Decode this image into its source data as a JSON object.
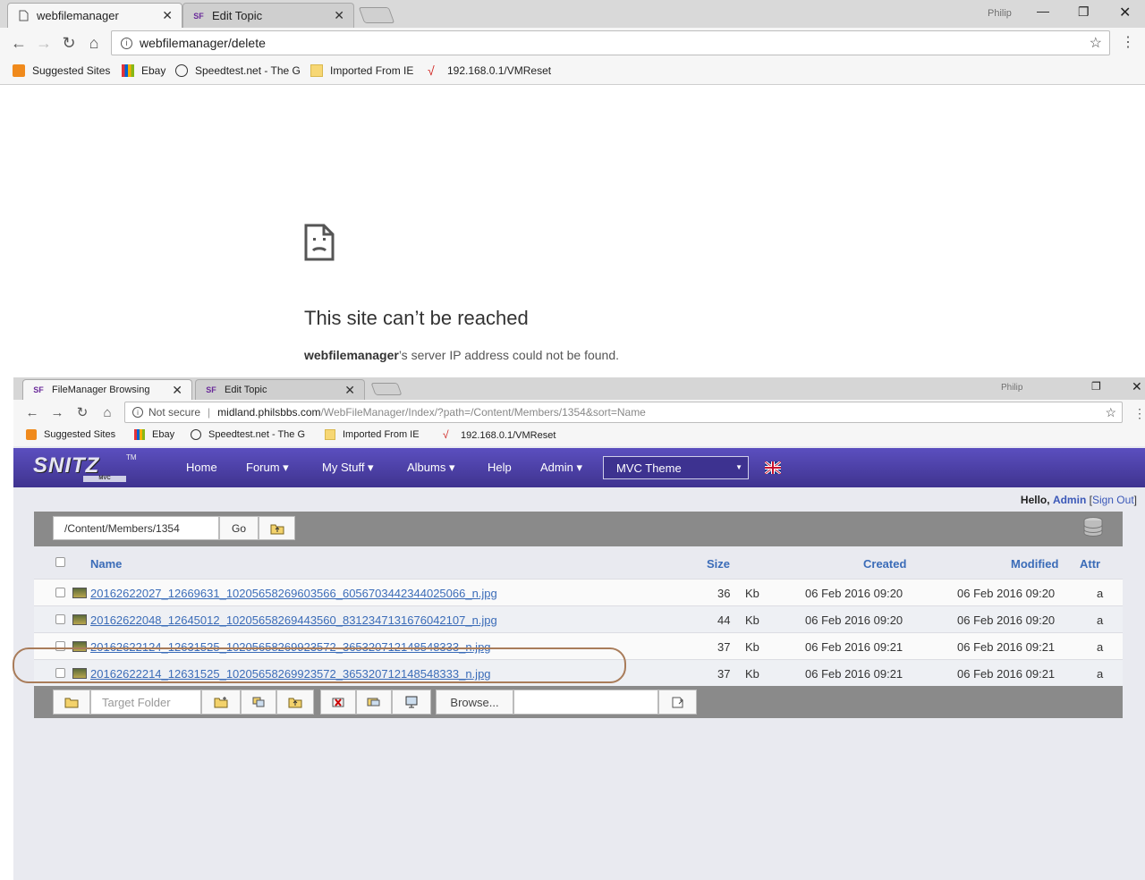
{
  "top_browser": {
    "tabs": [
      {
        "label": "webfilemanager",
        "active": true
      },
      {
        "label": "Edit Topic",
        "active": false
      }
    ],
    "user": "Philip",
    "url": "webfilemanager/delete",
    "bookmarks": [
      "Suggested Sites",
      "Ebay",
      "Speedtest.net - The G",
      "Imported From IE",
      "192.168.0.1/VMReset"
    ],
    "error": {
      "title": "This site can’t be reached",
      "host": "webfilemanager",
      "message": "’s server IP address could not be found."
    }
  },
  "bottom_browser": {
    "tabs": [
      {
        "label": "FileManager Browsing",
        "active": true
      },
      {
        "label": "Edit Topic",
        "active": false
      }
    ],
    "user": "Philip",
    "security": "Not secure",
    "url_host": "midland.philsbbs.com",
    "url_path": "/WebFileManager/Index/?path=/Content/Members/1354&sort=Name",
    "bookmarks": [
      "Suggested Sites",
      "Ebay",
      "Speedtest.net - The G",
      "Imported From IE",
      "192.168.0.1/VMReset"
    ],
    "site": {
      "logo": "SNITZ",
      "logo_sub": "MVC",
      "logo_tm": "TM",
      "nav": [
        "Home",
        "Forum ▾",
        "My Stuff ▾",
        "Albums ▾",
        "Help",
        "Admin ▾"
      ],
      "theme": "MVC Theme",
      "hello_prefix": "Hello,",
      "user": "Admin",
      "sign_out": "Sign Out"
    },
    "path_bar": {
      "path": "/Content/Members/1354",
      "go_label": "Go"
    },
    "table": {
      "headers": {
        "name": "Name",
        "size": "Size",
        "created": "Created",
        "modified": "Modified",
        "attr": "Attr"
      },
      "rows": [
        {
          "name": "20162622027_12669631_10205658269603566_6056703442344025066_n.jpg",
          "size": "36",
          "unit": "Kb",
          "created": "06 Feb 2016 09:20",
          "modified": "06 Feb 2016 09:20",
          "attr": "a"
        },
        {
          "name": "20162622048_12645012_10205658269443560_8312347131676042107_n.jpg",
          "size": "44",
          "unit": "Kb",
          "created": "06 Feb 2016 09:20",
          "modified": "06 Feb 2016 09:20",
          "attr": "a"
        },
        {
          "name": "20162622124_12631525_10205658269923572_365320712148548333_n.jpg",
          "size": "37",
          "unit": "Kb",
          "created": "06 Feb 2016 09:21",
          "modified": "06 Feb 2016 09:21",
          "attr": "a"
        },
        {
          "name": "20162622214_12631525_10205658269923572_365320712148548333_n.jpg",
          "size": "37",
          "unit": "Kb",
          "created": "06 Feb 2016 09:21",
          "modified": "06 Feb 2016 09:21",
          "attr": "a"
        }
      ]
    },
    "actions": {
      "target_placeholder": "Target Folder",
      "browse_label": "Browse..."
    }
  },
  "colors": {
    "nav_gradient_top": "#5b4fbf",
    "nav_gradient_bottom": "#3f338f",
    "link": "#3b6cb8",
    "bar_gray": "#8a8a8a",
    "annotation": "#a97c5a"
  }
}
